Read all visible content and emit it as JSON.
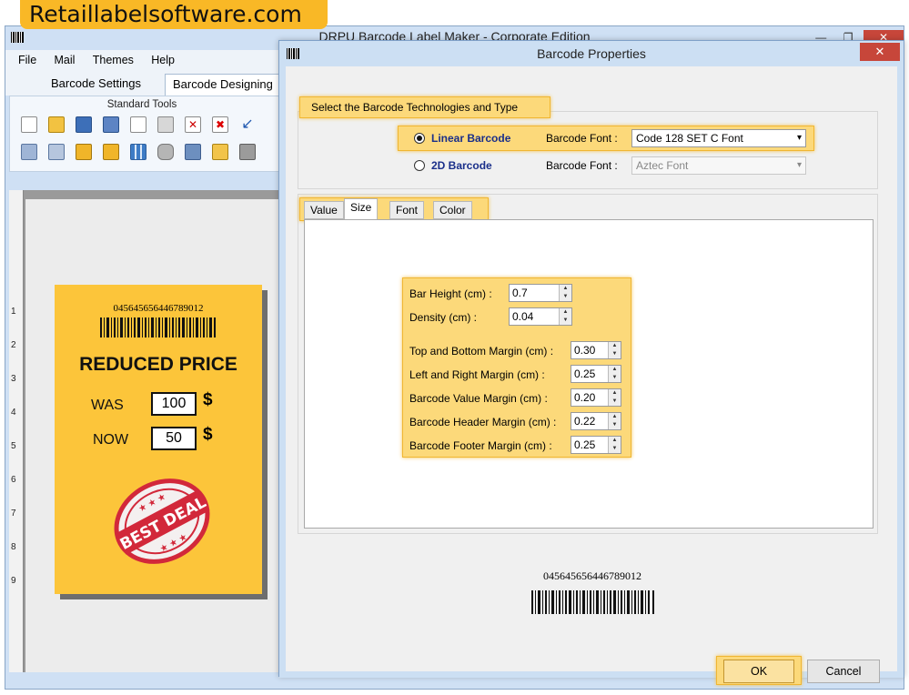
{
  "watermark": "Retaillabelsoftware.com",
  "main_window": {
    "title": "DRPU Barcode Label Maker - Corporate Edition",
    "controls": {
      "minimize": "—",
      "restore": "❐",
      "close": "✕"
    }
  },
  "menu": [
    "File",
    "Mail",
    "Themes",
    "Help"
  ],
  "main_tabs": [
    "Barcode Settings",
    "Barcode Designing"
  ],
  "ribbon": {
    "group_label": "Standard Tools"
  },
  "ruler": [
    "1",
    "2",
    "3",
    "4",
    "5",
    "6",
    "7",
    "8",
    "9"
  ],
  "label_card": {
    "barcode_number": "045645656446789012",
    "title": "REDUCED PRICE",
    "was_label": "WAS",
    "was_value": "100",
    "now_label": "NOW",
    "now_value": "50",
    "currency": "$",
    "stamp_text": "BEST DEAL"
  },
  "dialog": {
    "title": "Barcode Properties",
    "close": "✕",
    "tech_legend": "Select the Barcode Technologies and Type",
    "linear": {
      "label": "Linear Barcode",
      "font_label": "Barcode Font :",
      "font_value": "Code 128 SET C Font",
      "selected": true
    },
    "twod": {
      "label": "2D Barcode",
      "font_label": "Barcode Font :",
      "font_value": "Aztec Font",
      "selected": false
    },
    "tabs": [
      "Value",
      "Size",
      "Font",
      "Color"
    ],
    "active_tab": "Size",
    "size_fields": [
      {
        "label": "Bar Height (cm) :",
        "value": "0.7"
      },
      {
        "label": "Density (cm) :",
        "value": "0.04"
      },
      {
        "label": "Top and Bottom Margin (cm) :",
        "value": "0.30"
      },
      {
        "label": "Left and Right Margin (cm) :",
        "value": "0.25"
      },
      {
        "label": "Barcode Value Margin (cm) :",
        "value": "0.20"
      },
      {
        "label": "Barcode Header Margin (cm) :",
        "value": "0.22"
      },
      {
        "label": "Barcode Footer Margin (cm) :",
        "value": "0.25"
      }
    ],
    "preview_number": "045645656446789012",
    "ok": "OK",
    "cancel": "Cancel"
  }
}
